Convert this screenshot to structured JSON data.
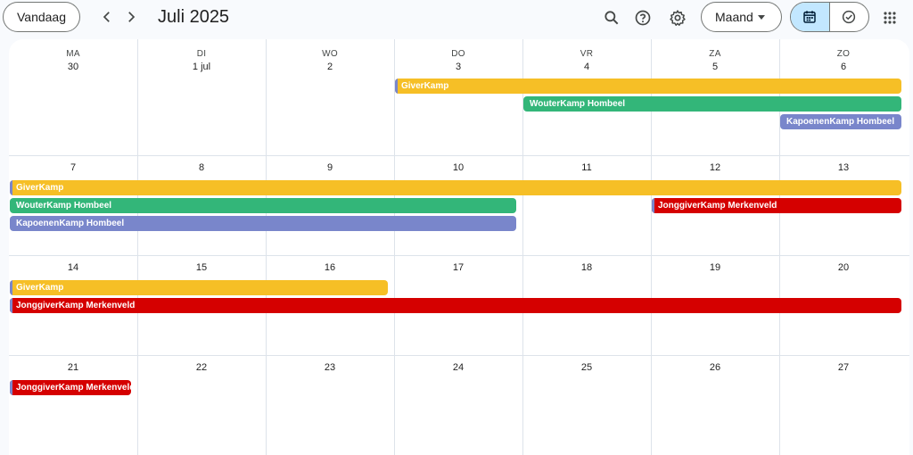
{
  "header": {
    "today_label": "Vandaag",
    "month_title": "Juli 2025",
    "view_label": "Maand",
    "icons": [
      "chevron-left-icon",
      "chevron-right-icon",
      "search-icon",
      "help-icon",
      "gear-icon",
      "calendar-icon",
      "tasks-icon",
      "apps-grid-icon"
    ]
  },
  "calendar": {
    "weekdays": [
      "MA",
      "DI",
      "WO",
      "DO",
      "VR",
      "ZA",
      "ZO"
    ],
    "weeks": [
      [
        "30",
        "1 jul",
        "2",
        "3",
        "4",
        "5",
        "6"
      ],
      [
        "7",
        "8",
        "9",
        "10",
        "11",
        "12",
        "13"
      ],
      [
        "14",
        "15",
        "16",
        "17",
        "18",
        "19",
        "20"
      ],
      [
        "21",
        "22",
        "23",
        "24",
        "25",
        "26",
        "27"
      ]
    ],
    "events": [
      {
        "label": "GiverKamp",
        "color": "#f6bf26",
        "text_color": "#fff",
        "week": 0,
        "start": 3,
        "span": 4,
        "lane": 0,
        "stripe": true
      },
      {
        "label": "WouterKamp Hombeel",
        "color": "#33b679",
        "text_color": "#fff",
        "week": 0,
        "start": 4,
        "span": 3,
        "lane": 1,
        "stripe": false
      },
      {
        "label": "KapoenenKamp Hombeel",
        "color": "#7986cb",
        "text_color": "#fff",
        "week": 0,
        "start": 6,
        "span": 1,
        "lane": 2,
        "stripe": false
      },
      {
        "label": "GiverKamp",
        "color": "#f6bf26",
        "text_color": "#fff",
        "week": 1,
        "start": 0,
        "span": 7,
        "lane": 0,
        "stripe": true
      },
      {
        "label": "WouterKamp Hombeel",
        "color": "#33b679",
        "text_color": "#fff",
        "week": 1,
        "start": 0,
        "span": 4,
        "lane": 1,
        "stripe": false
      },
      {
        "label": "JonggiverKamp Merkenveld",
        "color": "#d50000",
        "text_color": "#fff",
        "week": 1,
        "start": 5,
        "span": 2,
        "lane": 1,
        "stripe": true
      },
      {
        "label": "KapoenenKamp Hombeel",
        "color": "#7986cb",
        "text_color": "#fff",
        "week": 1,
        "start": 0,
        "span": 4,
        "lane": 2,
        "stripe": false
      },
      {
        "label": "GiverKamp",
        "color": "#f6bf26",
        "text_color": "#fff",
        "week": 2,
        "start": 0,
        "span": 3,
        "lane": 0,
        "stripe": true
      },
      {
        "label": "JonggiverKamp Merkenveld",
        "color": "#d50000",
        "text_color": "#fff",
        "week": 2,
        "start": 0,
        "span": 7,
        "lane": 1,
        "stripe": true
      },
      {
        "label": "JonggiverKamp Merkenveld",
        "color": "#d50000",
        "text_color": "#fff",
        "week": 3,
        "start": 0,
        "span": 1,
        "lane": 0,
        "stripe": true
      }
    ]
  }
}
